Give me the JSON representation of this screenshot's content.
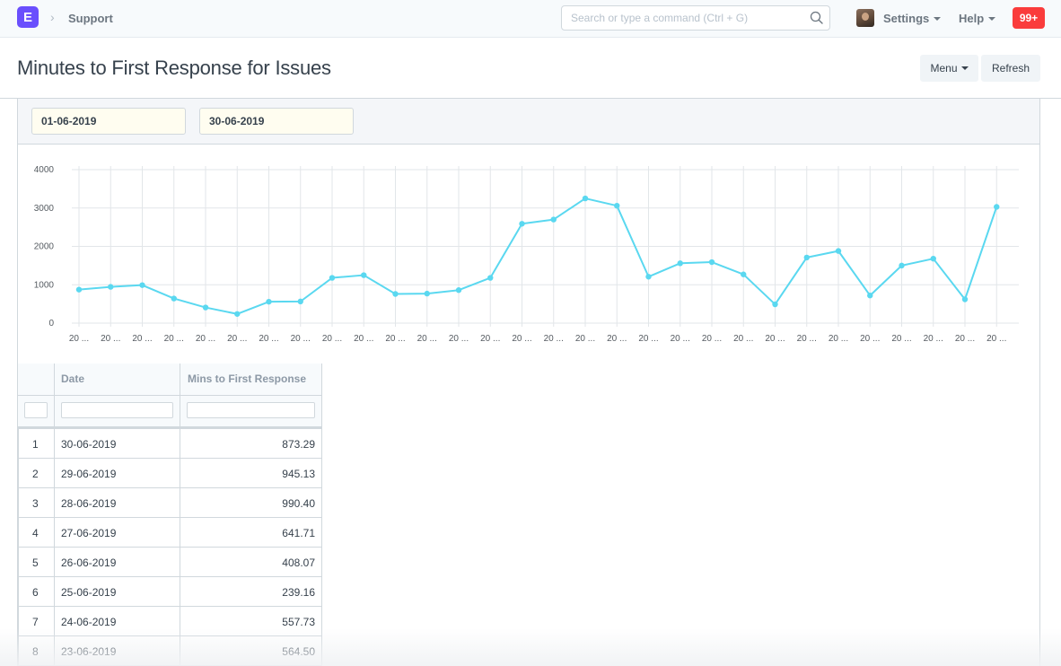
{
  "navbar": {
    "logo_letter": "E",
    "breadcrumb": "Support",
    "search_placeholder": "Search or type a command (Ctrl + G)",
    "settings_label": "Settings",
    "help_label": "Help",
    "notification_count": "99+"
  },
  "page": {
    "title": "Minutes to First Response for Issues",
    "menu_label": "Menu",
    "refresh_label": "Refresh"
  },
  "filters": {
    "from_date": "01-06-2019",
    "to_date": "30-06-2019"
  },
  "colors": {
    "accent": "#5e64ff",
    "logo": "#6a4ffd",
    "line": "#5ad8f0",
    "notification": "#fa3c3c"
  },
  "chart_data": {
    "type": "line",
    "title": "",
    "xlabel": "",
    "ylabel": "",
    "x_tick_label": "20 ...",
    "y_ticks": [
      0,
      1000,
      2000,
      3000,
      4000
    ],
    "ylim": [
      0,
      4000
    ],
    "grid": true,
    "series": [
      {
        "values": [
          873.29,
          945.13,
          990.4,
          641.71,
          408.07,
          239.16,
          557.73,
          564.5,
          1180,
          1250,
          760,
          770,
          860,
          1180,
          2590,
          2700,
          3250,
          3060,
          1210,
          1560,
          1590,
          1270,
          490,
          1710,
          1880,
          720,
          1500,
          1680,
          620,
          3030
        ]
      }
    ]
  },
  "table": {
    "columns": [
      "Date",
      "Mins to First Response"
    ],
    "rows": [
      {
        "index": "1",
        "date": "30-06-2019",
        "mins": "873.29"
      },
      {
        "index": "2",
        "date": "29-06-2019",
        "mins": "945.13"
      },
      {
        "index": "3",
        "date": "28-06-2019",
        "mins": "990.40"
      },
      {
        "index": "4",
        "date": "27-06-2019",
        "mins": "641.71"
      },
      {
        "index": "5",
        "date": "26-06-2019",
        "mins": "408.07"
      },
      {
        "index": "6",
        "date": "25-06-2019",
        "mins": "239.16"
      },
      {
        "index": "7",
        "date": "24-06-2019",
        "mins": "557.73"
      },
      {
        "index": "8",
        "date": "23-06-2019",
        "mins": "564.50"
      }
    ]
  }
}
